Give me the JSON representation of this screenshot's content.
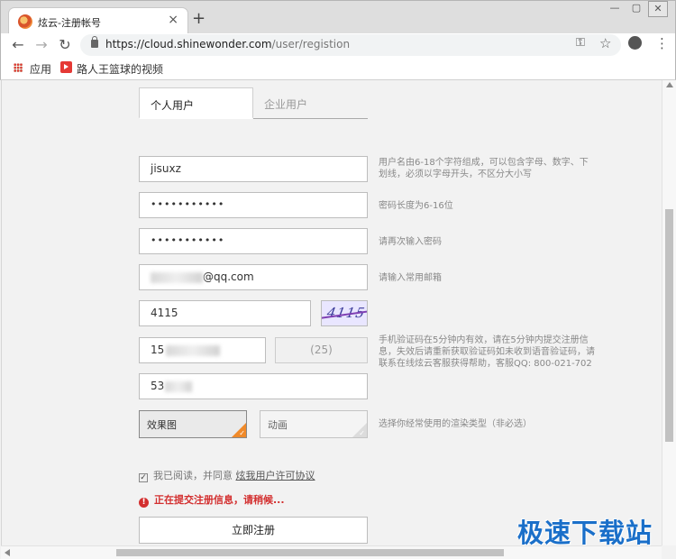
{
  "browser": {
    "tab_title": "炫云-注册帐号",
    "tab_close": "×",
    "new_tab": "+",
    "url_host": "https://cloud.shinewonder.com",
    "url_path": "/user/registion",
    "bookmarks": [
      {
        "label": "应用",
        "icon": "apps-grid-icon"
      },
      {
        "label": "路人王篮球的视频",
        "icon": "video-icon"
      }
    ]
  },
  "tabs": {
    "personal": "个人用户",
    "enterprise": "企业用户"
  },
  "form": {
    "username": "jisuxz",
    "username_hint": "用户名由6-18个字符组成，可以包含字母、数字、下划线，必须以字母开头，不区分大小写",
    "password": "•••••••••••",
    "password_hint": "密码长度为6-16位",
    "password_confirm": "•••••••••••",
    "password_confirm_hint": "请再次输入密码",
    "email_suffix": "@qq.com",
    "email_hint": "请输入常用邮箱",
    "captcha_value": "4115",
    "captcha_image_text": "4115",
    "phone_prefix": "15",
    "sms_countdown": "(25)",
    "sms_hint": "手机验证码在5分钟内有效，请在5分钟内提交注册信息，失效后请重新获取验证码如未收到语音验证码，请联系在线炫云客服获得帮助，客服QQ: 800-021-702",
    "sms_code_prefix": "53",
    "render_options": [
      "效果图",
      "动画"
    ],
    "render_hint": "选择你经常使用的渲染类型（非必选）",
    "agree_text": "我已阅读，并同意",
    "agree_link": "炫我用户许可协议",
    "error_text": "正在提交注册信息，请稍候...",
    "submit_label": "立即注册"
  },
  "watermark": "极速下载站",
  "colors": {
    "accent_orange": "#f08a2a",
    "error_red": "#d32f2f",
    "watermark_blue": "#1a6fc9"
  }
}
